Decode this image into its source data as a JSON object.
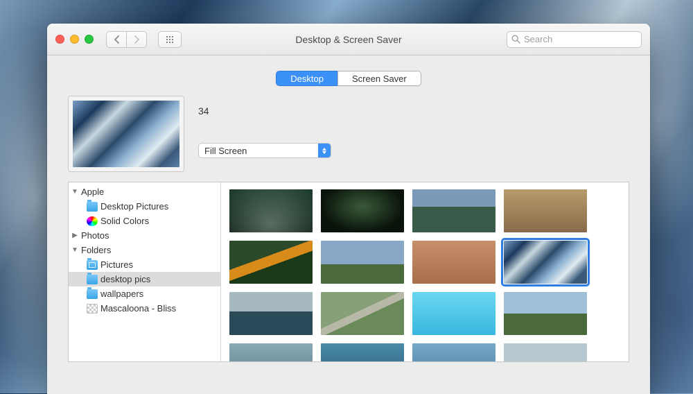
{
  "window": {
    "title": "Desktop & Screen Saver"
  },
  "toolbar": {
    "search_placeholder": "Search"
  },
  "tabs": {
    "desktop": "Desktop",
    "screensaver": "Screen Saver",
    "active": "desktop"
  },
  "preview": {
    "name": "34",
    "fit_mode_label": "Fill Screen"
  },
  "sidebar": {
    "groups": [
      {
        "label": "Apple",
        "expanded": true,
        "children": [
          {
            "label": "Desktop Pictures",
            "icon": "folder"
          },
          {
            "label": "Solid Colors",
            "icon": "colorwheel"
          }
        ]
      },
      {
        "label": "Photos",
        "expanded": false,
        "children": []
      },
      {
        "label": "Folders",
        "expanded": true,
        "children": [
          {
            "label": "Pictures",
            "icon": "folder-pic"
          },
          {
            "label": "desktop pics",
            "icon": "folder",
            "selected": true
          },
          {
            "label": "wallpapers",
            "icon": "folder"
          },
          {
            "label": "Mascaloona - Bliss",
            "icon": "checker"
          }
        ]
      }
    ]
  },
  "thumbnails": {
    "selected_index": 7,
    "count": 16
  }
}
